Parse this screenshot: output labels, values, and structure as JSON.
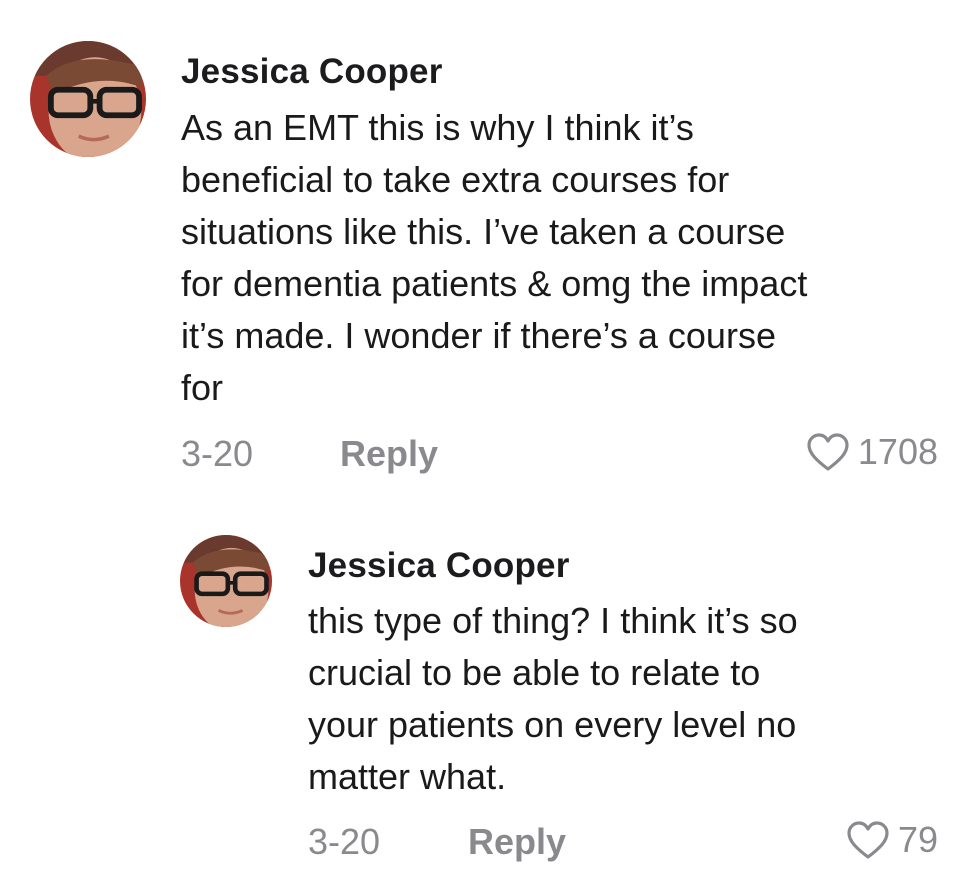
{
  "comments": [
    {
      "username": "Jessica Cooper",
      "lines": [
        "As an EMT this is why I think it’s",
        "beneficial to take extra courses for",
        "situations like this. I’ve taken a course",
        "for dementia patients & omg the impact",
        "it’s made. I wonder if there’s a course",
        "for"
      ],
      "date": "3-20",
      "reply_label": "Reply",
      "likes": "1708",
      "like_icon": "heart-outline-icon",
      "avatar_icon": "profile-photo"
    },
    {
      "username": "Jessica Cooper",
      "lines": [
        "this type of thing? I think it’s so",
        "crucial to be able to relate to",
        "your patients on every level no",
        "matter what."
      ],
      "date": "3-20",
      "reply_label": "Reply",
      "likes": "79",
      "like_icon": "heart-outline-icon",
      "avatar_icon": "profile-photo"
    }
  ],
  "colors": {
    "username": "#1c1c1e",
    "body": "#1a1a1a",
    "meta": "#8a8a8e",
    "background": "#ffffff"
  }
}
